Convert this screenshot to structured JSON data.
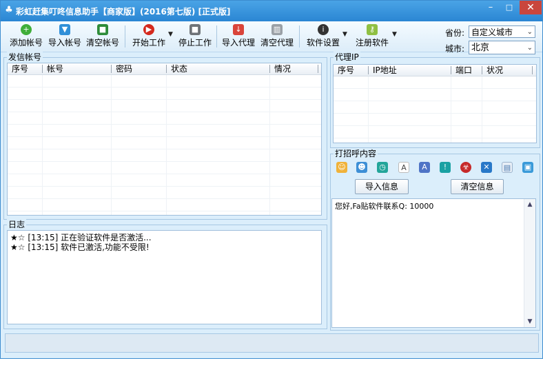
{
  "window": {
    "title": "彩虹赶集叮咚信息助手【商家版】(2016第七版) [正式版]",
    "btn_min": "–",
    "btn_max": "□",
    "btn_close": "✕"
  },
  "toolbar": {
    "add_account": "添加帐号",
    "import_account": "导入帐号",
    "clear_account": "清空帐号",
    "start_work": "开始工作",
    "stop_work": "停止工作",
    "import_proxy": "导入代理",
    "clear_proxy": "清空代理",
    "settings": "软件设置",
    "register": "注册软件"
  },
  "region": {
    "province_label": "省份:",
    "province_value": "自定义城市",
    "city_label": "城市:",
    "city_value": "北京"
  },
  "accounts": {
    "title": "发信帐号",
    "columns": [
      "序号",
      "帐号",
      "密码",
      "状态",
      "情况"
    ]
  },
  "proxy": {
    "title": "代理IP",
    "columns": [
      "序号",
      "IP地址",
      "端口",
      "状况"
    ]
  },
  "greeting": {
    "title": "打招呼内容",
    "import_btn": "导入信息",
    "clear_btn": "清空信息",
    "text": "您好,Fa贴软件联系Q: 10000",
    "icons": [
      "user-icon",
      "contact-icon",
      "alarm-icon",
      "font-icon",
      "font-bold-icon",
      "alert-icon",
      "biohazard-icon",
      "delete-icon",
      "document-icon",
      "image-icon"
    ]
  },
  "log": {
    "title": "日志",
    "lines": [
      "★☆ [13:15] 正在验证软件是否激活...",
      "★☆ [13:15] 软件已激活,功能不受限!"
    ]
  },
  "colors": {
    "titlebar": "#2a86d3",
    "panel": "#dbeefb",
    "close": "#c9463d"
  }
}
